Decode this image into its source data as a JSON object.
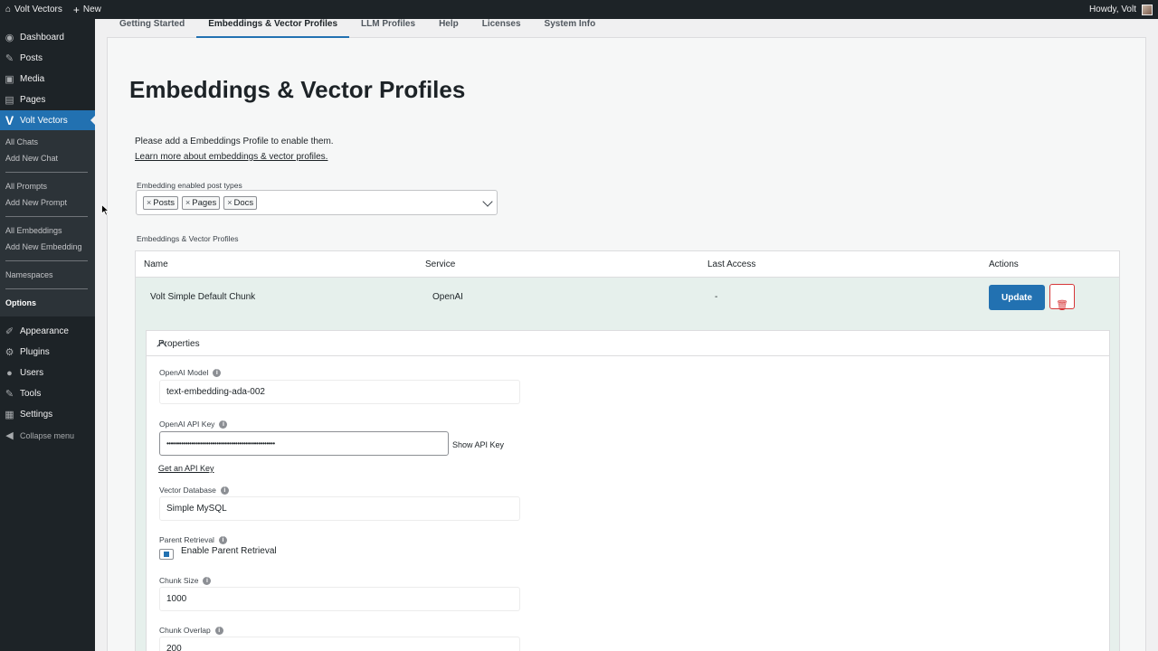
{
  "adminbar": {
    "site_name": "Volt Vectors",
    "new_label": "New",
    "howdy": "Howdy, Volt"
  },
  "sidebar": {
    "items_top": [
      {
        "label": "Dashboard",
        "icon": "dashboard-icon",
        "glyph": "◉"
      },
      {
        "label": "Posts",
        "icon": "pin-icon",
        "glyph": "✎"
      },
      {
        "label": "Media",
        "icon": "media-icon",
        "glyph": "▣"
      },
      {
        "label": "Pages",
        "icon": "pages-icon",
        "glyph": "▤"
      }
    ],
    "current": {
      "label": "Volt Vectors",
      "icon": "volt-v-icon",
      "glyph": "V"
    },
    "submenu": {
      "chats": [
        "All Chats",
        "Add New Chat"
      ],
      "prompts": [
        "All Prompts",
        "Add New Prompt"
      ],
      "embeddings": [
        "All Embeddings",
        "Add New Embedding"
      ],
      "namespaces": "Namespaces",
      "options": "Options"
    },
    "items_bottom": [
      {
        "label": "Appearance",
        "icon": "appearance-icon",
        "glyph": "✐"
      },
      {
        "label": "Plugins",
        "icon": "plugins-icon",
        "glyph": "⚙"
      },
      {
        "label": "Users",
        "icon": "users-icon",
        "glyph": "●"
      },
      {
        "label": "Tools",
        "icon": "tools-icon",
        "glyph": "✎"
      },
      {
        "label": "Settings",
        "icon": "settings-icon",
        "glyph": "▦"
      },
      {
        "label": "Collapse menu",
        "icon": "collapse-icon",
        "glyph": "◀"
      }
    ]
  },
  "tabs": [
    "Getting Started",
    "Embeddings & Vector Profiles",
    "LLM Profiles",
    "Help",
    "Licenses",
    "System Info"
  ],
  "active_tab": 1,
  "page": {
    "title": "Embeddings & Vector Profiles",
    "notice": "Please add a Embeddings Profile to enable them.",
    "learn_more": "Learn more about embeddings & vector profiles.",
    "post_types_label": "Embedding enabled post types",
    "post_types": [
      "Posts",
      "Pages",
      "Docs"
    ],
    "profiles_label": "Embeddings & Vector Profiles"
  },
  "table": {
    "headers": {
      "name": "Name",
      "service": "Service",
      "last_access": "Last Access",
      "actions": "Actions"
    },
    "row": {
      "name": "Volt Simple Default Chunk",
      "service": "OpenAI",
      "last_access": "-",
      "update": "Update"
    }
  },
  "properties": {
    "title": "Properties",
    "openai_model_label": "OpenAI Model",
    "openai_model": "text-embedding-ada-002",
    "api_key_label": "OpenAI API Key",
    "api_key": "••••••••••••••••••••••••••••••••••••••••••••••••••••",
    "show_api_key": "Show API Key",
    "get_api_key": "Get an API Key",
    "vector_db_label": "Vector Database",
    "vector_db": "Simple MySQL",
    "parent_retrieval_label": "Parent Retrieval",
    "enable_parent_retrieval": "Enable Parent Retrieval",
    "parent_retrieval_checked": true,
    "chunk_size_label": "Chunk Size",
    "chunk_size": "1000",
    "chunk_overlap_label": "Chunk Overlap",
    "chunk_overlap": "200"
  },
  "colors": {
    "accent": "#2271b1",
    "sidebar": "#1d2327",
    "delete": "#d63638",
    "row_bg": "#e6f0ec"
  }
}
